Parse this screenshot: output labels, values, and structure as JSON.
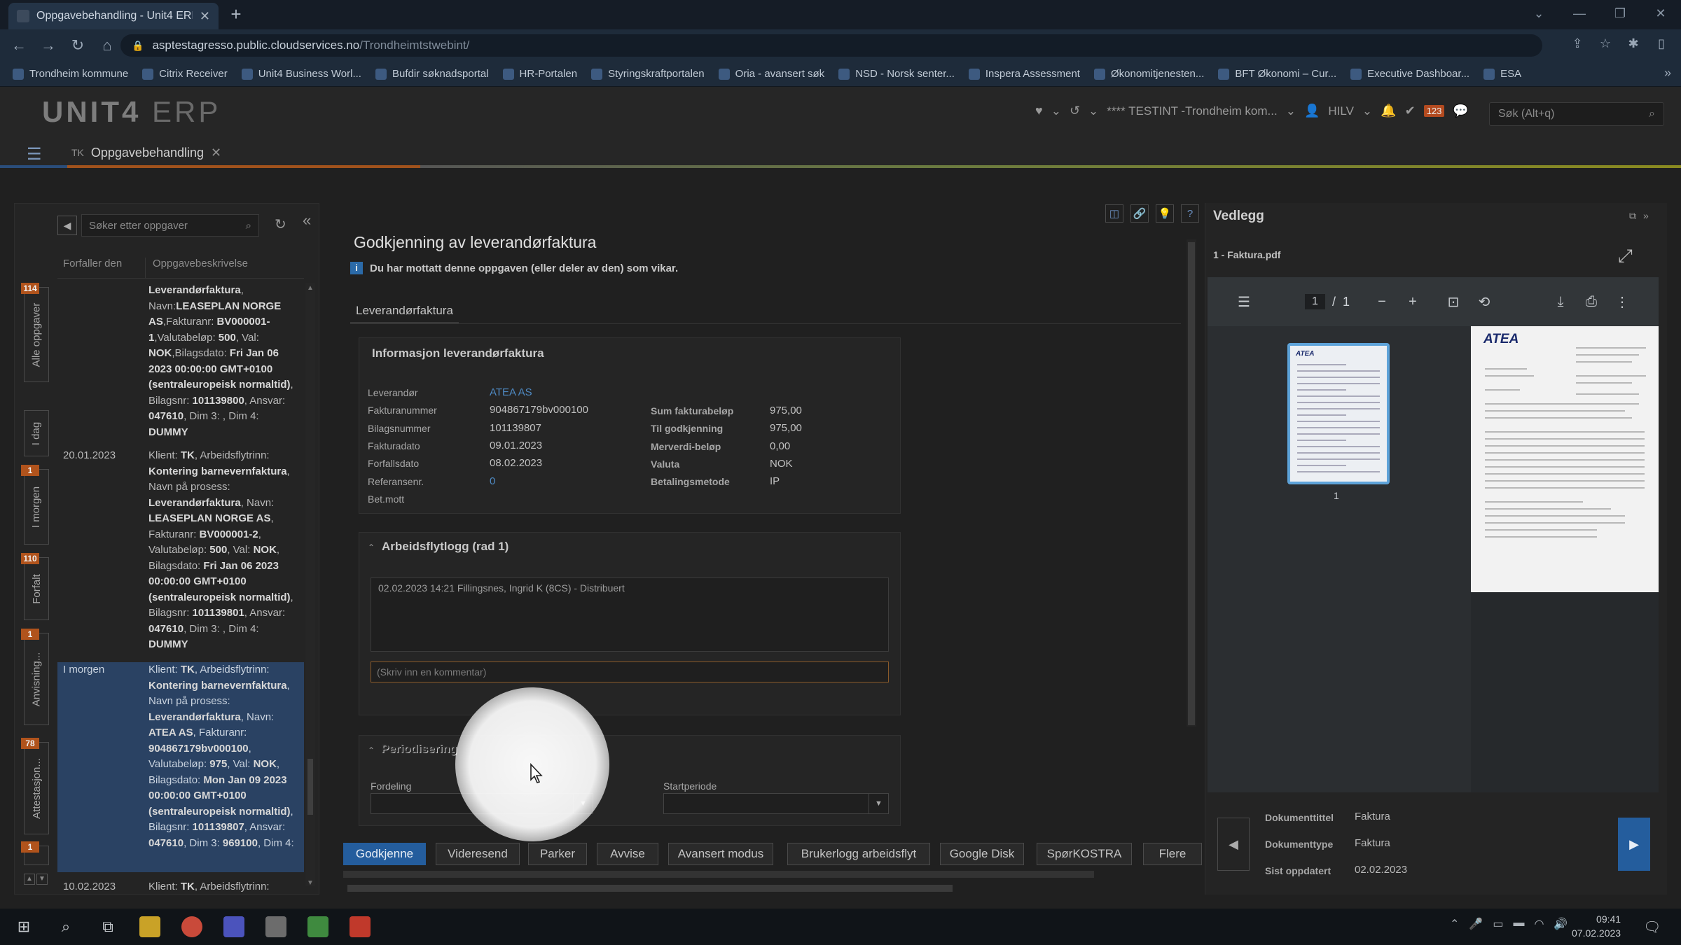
{
  "browser": {
    "tab_title": "Oppgavebehandling - Unit4 ERP",
    "url_host": "asptestagresso.public.cloudservices.no",
    "url_path": "/Trondheimtstwebint/",
    "bookmarks": [
      {
        "label": "Trondheim kommune"
      },
      {
        "label": "Citrix Receiver"
      },
      {
        "label": "Unit4 Business Worl..."
      },
      {
        "label": "Bufdir søknadsportal"
      },
      {
        "label": "HR-Portalen"
      },
      {
        "label": "Styringskraftportalen"
      },
      {
        "label": "Oria - avansert søk"
      },
      {
        "label": "NSD - Norsk senter..."
      },
      {
        "label": "Inspera Assessment"
      },
      {
        "label": "Økonomitjenesten..."
      },
      {
        "label": "BFT Økonomi – Cur..."
      },
      {
        "label": "Executive Dashboar..."
      },
      {
        "label": "ESA"
      }
    ]
  },
  "app": {
    "logo_main": "UNIT4",
    "logo_sub": "ERP",
    "client": "**** TESTINT -Trondheim kom...",
    "user": "HILV",
    "task_badge": "123",
    "search_placeholder": "Søk (Alt+q)",
    "tab_prefix": "TK",
    "tab_label": "Oppgavebehandling"
  },
  "task_panel": {
    "search_placeholder": "Søker etter oppgaver",
    "col_due": "Forfaller den",
    "col_desc": "Oppgavebeskrivelse",
    "vtabs": [
      {
        "label": "Alle oppgaver",
        "badge": "114"
      },
      {
        "label": "I dag",
        "badge": ""
      },
      {
        "label": "I morgen",
        "badge": "1"
      },
      {
        "label": "Forfalt",
        "badge": "110"
      },
      {
        "label": "Anvisning...",
        "badge": "1"
      },
      {
        "label": "Attestasjon...",
        "badge": "78"
      },
      {
        "label": "",
        "badge": "1"
      }
    ],
    "tasks": [
      {
        "due": "",
        "lines": [
          {
            "b": "Leverandørfaktura",
            "t": ", Navn:"
          },
          {
            "b": "LEASEPLAN NORGE AS",
            "t": ","
          },
          {
            "b": "",
            "t": "Fakturanr: "
          },
          {
            "b": "BV000001-1",
            "t": ","
          },
          {
            "b": "",
            "t": "Valutabeløp: "
          },
          {
            "b": "500",
            "t": ", Val: "
          },
          {
            "b": "NOK",
            "t": ","
          },
          {
            "b": "",
            "t": "Bilagsdato: "
          },
          {
            "b": "Fri Jan 06 2023 00:00:00 GMT+0100 (sentraleuropeisk normaltid)",
            "t": ", Bilagsnr: "
          },
          {
            "b": "101139800",
            "t": ", Ansvar: "
          },
          {
            "b": "047610",
            "t": ", Dim 3: , Dim 4: "
          },
          {
            "b": "DUMMY",
            "t": ""
          }
        ]
      },
      {
        "due": "20.01.2023",
        "lines": [
          {
            "b": "",
            "t": "Klient: "
          },
          {
            "b": "TK",
            "t": ", Arbeidsflytrinn: "
          },
          {
            "b": "Kontering barnevernfaktura",
            "t": ", Navn på prosess: "
          },
          {
            "b": "Leverandørfaktura",
            "t": ", Navn: "
          },
          {
            "b": "LEASEPLAN NORGE AS",
            "t": ", Fakturanr: "
          },
          {
            "b": "BV000001-2",
            "t": ", Valutabeløp: "
          },
          {
            "b": "500",
            "t": ", Val: "
          },
          {
            "b": "NOK",
            "t": ", Bilagsdato: "
          },
          {
            "b": "Fri Jan 06 2023 00:00:00 GMT+0100 (sentraleuropeisk normaltid)",
            "t": ", Bilagsnr: "
          },
          {
            "b": "101139801",
            "t": ", Ansvar: "
          },
          {
            "b": "047610",
            "t": ", Dim 3: , Dim 4: "
          },
          {
            "b": "DUMMY",
            "t": ""
          }
        ]
      },
      {
        "due": "I morgen",
        "lines": [
          {
            "b": "",
            "t": "Klient: "
          },
          {
            "b": "TK",
            "t": ", Arbeidsflytrinn: "
          },
          {
            "b": "Kontering barnevernfaktura",
            "t": ", Navn på prosess: "
          },
          {
            "b": "Leverandørfaktura",
            "t": ", Navn: "
          },
          {
            "b": "ATEA AS",
            "t": ", Fakturanr: "
          },
          {
            "b": "904867179bv000100",
            "t": ", Valutabeløp: "
          },
          {
            "b": "975",
            "t": ", Val: "
          },
          {
            "b": "NOK",
            "t": ", Bilagsdato: "
          },
          {
            "b": "Mon Jan 09 2023 00:00:00 GMT+0100 (sentraleuropeisk normaltid)",
            "t": ", Bilagsnr: "
          },
          {
            "b": "101139807",
            "t": ", Ansvar: "
          },
          {
            "b": "047610",
            "t": ", Dim 3: "
          },
          {
            "b": "969100",
            "t": ", Dim 4:"
          }
        ]
      },
      {
        "due": "10.02.2023",
        "lines": [
          {
            "b": "",
            "t": "Klient: "
          },
          {
            "b": "TK",
            "t": ", Arbeidsflytrinn:"
          }
        ]
      }
    ]
  },
  "form": {
    "title": "Godkjenning av leverandørfaktura",
    "info": "Du har mottatt denne oppgaven (eller deler av den) som vikar.",
    "tab": "Leverandørfaktura",
    "section_info": {
      "title": "Informasjon leverandørfaktura",
      "left": [
        {
          "label": "Leverandør",
          "value": "ATEA AS",
          "link": true
        },
        {
          "label": "Fakturanummer",
          "value": "904867179bv000100"
        },
        {
          "label": "Bilagsnummer",
          "value": "101139807"
        },
        {
          "label": "Fakturadato",
          "value": "09.01.2023"
        },
        {
          "label": "Forfallsdato",
          "value": "08.02.2023"
        },
        {
          "label": "Referansenr.",
          "value": "0",
          "link": true
        },
        {
          "label": "Bet.mott",
          "value": ""
        }
      ],
      "right": [
        {
          "label": "Sum fakturabeløp",
          "value": "975,00"
        },
        {
          "label": "Til godkjenning",
          "value": "975,00"
        },
        {
          "label": "Merverdi-beløp",
          "value": "0,00"
        },
        {
          "label": "Valuta",
          "value": "NOK"
        },
        {
          "label": "Betalingsmetode",
          "value": "IP"
        }
      ]
    },
    "section_log": {
      "title": "Arbeidsflytlogg (rad 1)",
      "entry": "02.02.2023 14:21 Fillingsnes, Ingrid K (8CS) - Distribuert",
      "comment_placeholder": "(Skriv inn en kommentar)"
    },
    "section_period": {
      "title": "Periodisering",
      "fordeling_label": "Fordeling",
      "startperiode_label": "Startperiode"
    },
    "actions": [
      "Godkjenne",
      "Videresend",
      "Parker",
      "Avvise",
      "Avansert modus",
      "Brukerlogg arbeidsflyt",
      "Google Disk",
      "SpørKOSTRA",
      "Flere"
    ]
  },
  "attachments": {
    "title": "Vedlegg",
    "file": "1 - Faktura.pdf",
    "viewer_page": "1",
    "viewer_total": "1",
    "thumb_label": "1",
    "page_logo": "ATEA",
    "doc_title_label": "Dokumenttittel",
    "doc_title": "Faktura",
    "doc_type_label": "Dokumenttype",
    "doc_type": "Faktura",
    "updated_label": "Sist oppdatert",
    "updated": "02.02.2023"
  },
  "taskbar": {
    "time": "09:41",
    "date": "07.02.2023"
  }
}
